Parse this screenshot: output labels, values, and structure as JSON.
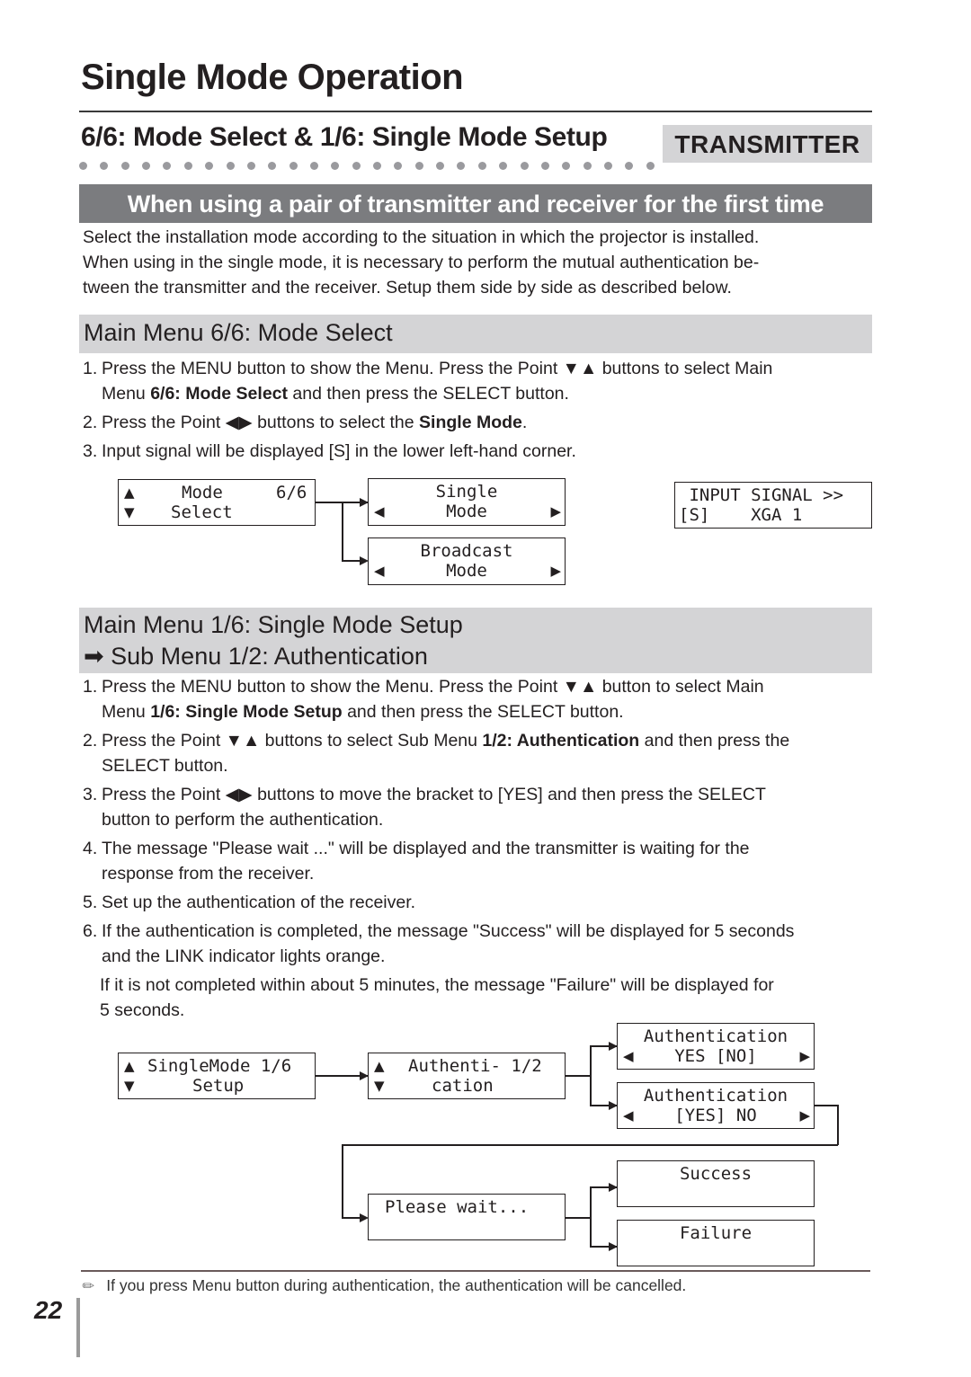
{
  "page": {
    "title": "Single Mode Operation",
    "section_heading": "6/6: Mode Select & 1/6: Single Mode Setup",
    "badge": "TRANSMITTER",
    "banner": "When using a pair of transmitter and receiver for the first time",
    "intro": [
      "Select the installation mode according to the situation in which the projector is installed.",
      "When using in the single mode, it is necessary to perform the mutual authentication be-",
      "tween the transmitter and the receiver. Setup them side by side as described below."
    ],
    "page_number": "22",
    "note_icon": "pencil-note-icon",
    "note": "If you press Menu button during authentication, the authentication will be cancelled."
  },
  "mode_select": {
    "heading": "Main Menu 6/6: Mode Select",
    "steps": [
      {
        "num": "1.",
        "l1_a": "Press the MENU button to show the Menu. Press the Point ",
        "l1_icon": "▼▲",
        "l1_b": " buttons to select Main",
        "l2_a": "Menu ",
        "l2_bold": "6/6: Mode Select",
        "l2_b": " and then press the SELECT button."
      },
      {
        "num": "2.",
        "a": "Press the Point ",
        "icon": "◀▶",
        "b": " buttons to select the ",
        "bold": "Single Mode",
        "c": "."
      },
      {
        "num": "3.",
        "text": "Input signal will be displayed [S] in the lower left-hand corner."
      }
    ],
    "lcd": {
      "menu": {
        "up": "▲",
        "down": "▼",
        "r1": "Mode",
        "r1_page": "6/6",
        "r2": "Select"
      },
      "single": {
        "r1": "Single",
        "r2": "Mode",
        "left": "◀",
        "right": "▶"
      },
      "broadcast": {
        "r1": "Broadcast",
        "r2": "Mode",
        "left": "◀",
        "right": "▶"
      },
      "input_signal": {
        "r1": " INPUT SIGNAL >>",
        "r2": "[S]    XGA 1"
      }
    }
  },
  "single_setup": {
    "heading_l1": "Main Menu 1/6: Single Mode Setup",
    "heading_arrow": "➡",
    "heading_l2": "Sub Menu 1/2: Authentication",
    "steps": [
      {
        "num": "1.",
        "l1_a": "Press the MENU button to show the Menu. Press the Point ",
        "l1_icon": "▼▲",
        "l1_b": " button to select Main",
        "l2_a": "Menu ",
        "l2_bold": "1/6: Single Mode Setup",
        "l2_b": " and then press the SELECT button."
      },
      {
        "num": "2.",
        "l1_a": "Press the Point ",
        "l1_icon": "▼▲",
        "l1_b": " buttons to select Sub Menu ",
        "l1_bold": "1/2: Authentication",
        "l1_c": " and then press the",
        "l2": "SELECT button."
      },
      {
        "num": "3.",
        "l1_a": "Press the Point ",
        "l1_icon": "◀▶",
        "l1_b": " buttons to move the bracket to [YES] and then press the SELECT",
        "l2": "button to perform the authentication."
      },
      {
        "num": "4.",
        "l1": "The message \"Please wait ...\" will be displayed and the transmitter is waiting for the",
        "l2": "response from the receiver."
      },
      {
        "num": "5.",
        "l1": "Set up the authentication of the receiver."
      },
      {
        "num": "6.",
        "l1": "If the authentication is completed, the message \"Success\" will be displayed for 5 seconds",
        "l2": "and the LINK indicator lights orange."
      }
    ],
    "extra_l1": "If it is not completed within about 5 minutes, the message \"Failure\" will be displayed for",
    "extra_l2": "5 seconds.",
    "lcd": {
      "menu": {
        "up": "▲",
        "down": "▼",
        "r1": "SingleMode 1/6",
        "r2": "Setup"
      },
      "sub": {
        "up": "▲",
        "down": "▼",
        "r1": "Authenti- 1/2",
        "r2": "cation"
      },
      "auth_no": {
        "r1": "Authentication",
        "r2": "YES [NO]",
        "left": "◀",
        "right": "▶"
      },
      "auth_yes": {
        "r1": "Authentication",
        "r2": "[YES] NO",
        "left": "◀",
        "right": "▶"
      },
      "wait": {
        "r1": "Please wait..."
      },
      "success": {
        "r1": "Success"
      },
      "failure": {
        "r1": "Failure"
      }
    }
  }
}
